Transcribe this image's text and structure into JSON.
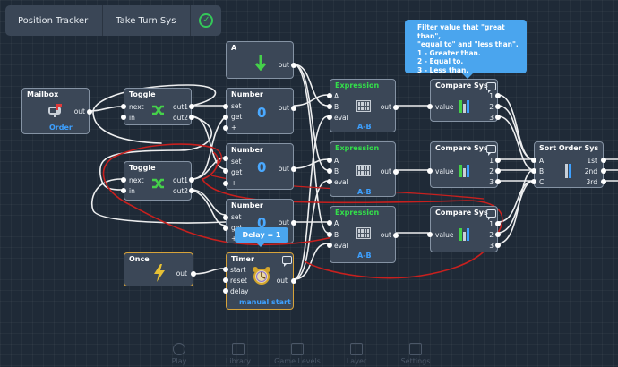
{
  "breadcrumb": {
    "items": [
      "Position Tracker",
      "Take Turn Sys"
    ],
    "status": "✓"
  },
  "nodes": {
    "mailbox": {
      "title": "Mailbox",
      "sub": "Order",
      "port_out": "out"
    },
    "toggle1": {
      "title": "Toggle",
      "ports_in": [
        "next",
        "in"
      ],
      "ports_out": [
        "out1",
        "out2"
      ]
    },
    "toggle2": {
      "title": "Toggle",
      "ports_in": [
        "next",
        "in"
      ],
      "ports_out": [
        "out1",
        "out2"
      ]
    },
    "number1": {
      "title": "Number",
      "ports_in": [
        "set",
        "get",
        "+"
      ],
      "port_out": "out",
      "value": "0"
    },
    "number2": {
      "title": "Number",
      "ports_in": [
        "set",
        "get",
        "+"
      ],
      "port_out": "out",
      "value": "0"
    },
    "number3": {
      "title": "Number",
      "ports_in": [
        "set",
        "get",
        "+"
      ],
      "port_out": "out",
      "value": "0"
    },
    "a": {
      "title": "A",
      "port_out": "out"
    },
    "expr1": {
      "title": "Expression",
      "ports_in": [
        "A",
        "B",
        "eval"
      ],
      "port_out": "out",
      "sub": "A-B"
    },
    "expr2": {
      "title": "Expression",
      "ports_in": [
        "A",
        "B",
        "eval"
      ],
      "port_out": "out",
      "sub": "A-B"
    },
    "expr3": {
      "title": "Expression",
      "ports_in": [
        "A",
        "B",
        "eval"
      ],
      "port_out": "out",
      "sub": "A-B"
    },
    "cmp1": {
      "title": "Compare Sys",
      "port_in": "value",
      "ports_out": [
        "1",
        "2",
        "3"
      ]
    },
    "cmp2": {
      "title": "Compare Sys",
      "port_in": "value",
      "ports_out": [
        "1",
        "2",
        "3"
      ]
    },
    "cmp3": {
      "title": "Compare Sys",
      "port_in": "value",
      "ports_out": [
        "1",
        "2",
        "3"
      ]
    },
    "sort": {
      "title": "Sort Order Sys",
      "ports_in": [
        "A",
        "B",
        "C"
      ],
      "ports_out": [
        "1st",
        "2nd",
        "3rd"
      ]
    },
    "once": {
      "title": "Once",
      "port_out": "out"
    },
    "timer": {
      "title": "Timer",
      "ports_in": [
        "start",
        "reset",
        "delay"
      ],
      "port_out": "out",
      "sub": "manual start"
    }
  },
  "tooltips": {
    "filter": [
      "Filter value that \"great than\",",
      "\"equal to\" and \"less than\".",
      "1 - Greater than.",
      "2 - Equal to.",
      "3 - Less than."
    ],
    "delay": "Delay = 1"
  },
  "bottom_nav": [
    "Play",
    "Library",
    "Game Levels",
    "Layer",
    "Settings"
  ],
  "colors": {
    "background": "#1f2a37",
    "node": "#3b4757",
    "selected_border": "#d7a33a",
    "accent_blue": "#4aa9ff",
    "expression_title": "#33e04a",
    "annotation_red": "#c8201e",
    "status_green": "#34c759"
  }
}
